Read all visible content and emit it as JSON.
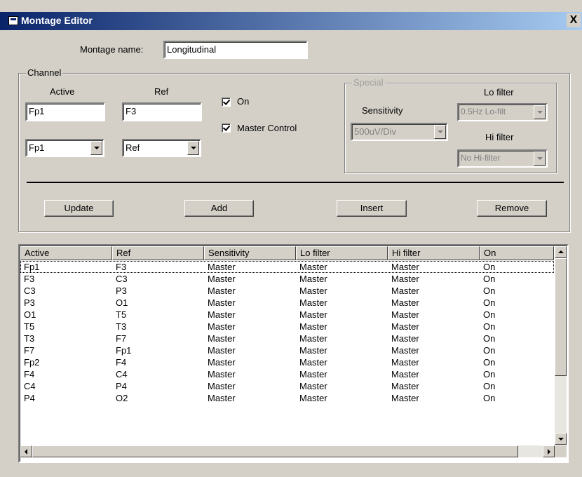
{
  "window": {
    "title": "Montage Editor",
    "close_glyph": "X"
  },
  "montage": {
    "name_label": "Montage name:",
    "name_value": "Longitudinal"
  },
  "channel": {
    "caption": "Channel",
    "active_label": "Active",
    "ref_label": "Ref",
    "active_value": "Fp1",
    "ref_value": "F3",
    "active_combo": "Fp1",
    "ref_combo": "Ref",
    "on_label": "On",
    "on_checked": true,
    "master_label": "Master Control",
    "master_checked": true
  },
  "special": {
    "caption": "Special",
    "sensitivity_label": "Sensitivity",
    "sensitivity_value": "500uV/Div",
    "lo_label": "Lo filter",
    "lo_value": "0.5Hz Lo-filt",
    "hi_label": "Hi filter",
    "hi_value": "No Hi-filter"
  },
  "buttons": {
    "update": "Update",
    "add": "Add",
    "insert": "Insert",
    "remove": "Remove"
  },
  "table": {
    "columns": [
      "Active",
      "Ref",
      "Sensitivity",
      "Lo filter",
      "Hi filter",
      "On"
    ],
    "rows": [
      [
        "Fp1",
        "F3",
        "Master",
        "Master",
        "Master",
        "On"
      ],
      [
        "F3",
        "C3",
        "Master",
        "Master",
        "Master",
        "On"
      ],
      [
        "C3",
        "P3",
        "Master",
        "Master",
        "Master",
        "On"
      ],
      [
        "P3",
        "O1",
        "Master",
        "Master",
        "Master",
        "On"
      ],
      [
        "O1",
        "T5",
        "Master",
        "Master",
        "Master",
        "On"
      ],
      [
        "T5",
        "T3",
        "Master",
        "Master",
        "Master",
        "On"
      ],
      [
        "T3",
        "F7",
        "Master",
        "Master",
        "Master",
        "On"
      ],
      [
        "F7",
        "Fp1",
        "Master",
        "Master",
        "Master",
        "On"
      ],
      [
        "Fp2",
        "F4",
        "Master",
        "Master",
        "Master",
        "On"
      ],
      [
        "F4",
        "C4",
        "Master",
        "Master",
        "Master",
        "On"
      ],
      [
        "C4",
        "P4",
        "Master",
        "Master",
        "Master",
        "On"
      ],
      [
        "P4",
        "O2",
        "Master",
        "Master",
        "Master",
        "On"
      ]
    ]
  }
}
